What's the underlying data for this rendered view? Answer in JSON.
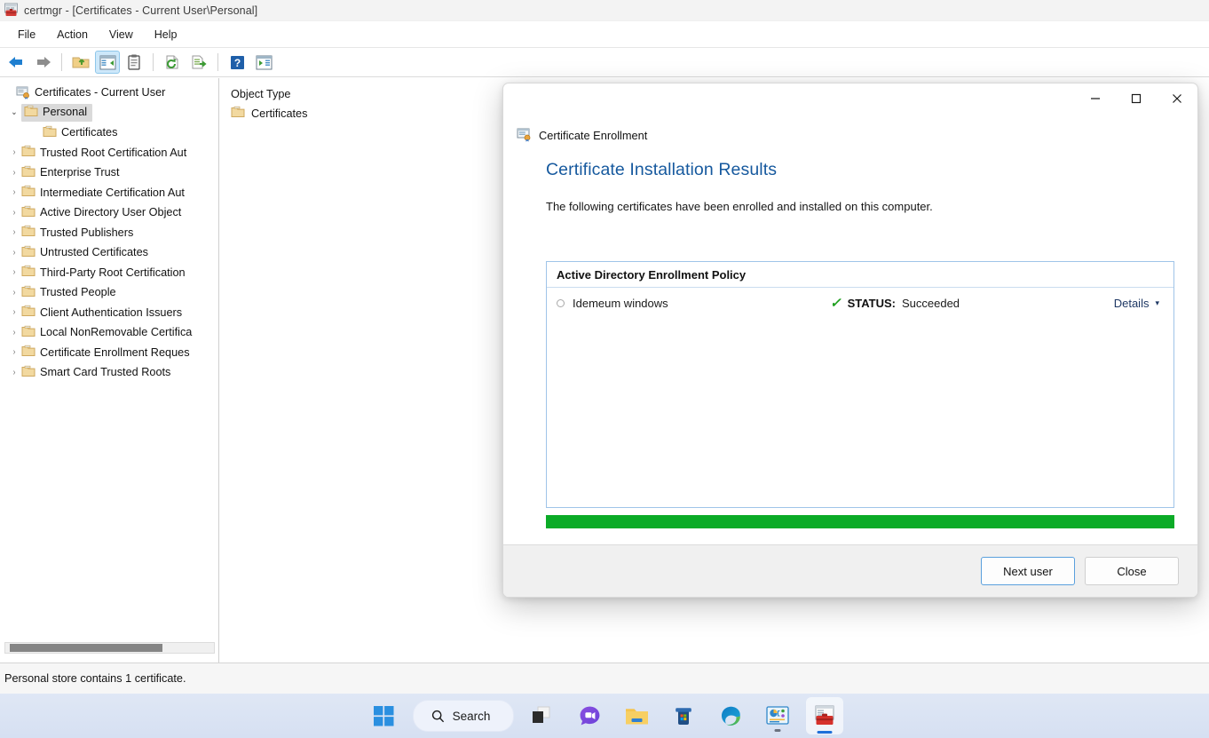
{
  "window": {
    "title": "certmgr - [Certificates - Current User\\Personal]",
    "icon": "certmgr-toolbox-icon"
  },
  "menubar": {
    "items": [
      {
        "label": "File",
        "name": "menu-file"
      },
      {
        "label": "Action",
        "name": "menu-action"
      },
      {
        "label": "View",
        "name": "menu-view"
      },
      {
        "label": "Help",
        "name": "menu-help"
      }
    ]
  },
  "toolbar": {
    "buttons": [
      {
        "name": "back-icon",
        "glyph": "back-arrow"
      },
      {
        "name": "forward-icon",
        "glyph": "forward-arrow"
      },
      {
        "name": "up-one-level-icon",
        "glyph": "folder-up"
      },
      {
        "name": "show-hide-console-tree-icon",
        "glyph": "console-tree",
        "active": true
      },
      {
        "name": "properties-icon",
        "glyph": "clipboard"
      },
      {
        "name": "refresh-icon",
        "glyph": "refresh-page"
      },
      {
        "name": "export-list-icon",
        "glyph": "export-list"
      },
      {
        "name": "help-icon",
        "glyph": "question-mark"
      },
      {
        "name": "show-action-pane-icon",
        "glyph": "action-pane"
      }
    ]
  },
  "tree": {
    "root": {
      "label": "Certificates - Current User",
      "icon": "certificates-root-icon"
    },
    "items": [
      {
        "label": "Personal",
        "twisty": "open",
        "selected": true,
        "indent": 1
      },
      {
        "label": "Certificates",
        "twisty": "none",
        "selected": false,
        "indent": 2
      },
      {
        "label": "Trusted Root Certification Aut",
        "twisty": "closed",
        "selected": false,
        "indent": 1
      },
      {
        "label": "Enterprise Trust",
        "twisty": "closed",
        "selected": false,
        "indent": 1
      },
      {
        "label": "Intermediate Certification Aut",
        "twisty": "closed",
        "selected": false,
        "indent": 1
      },
      {
        "label": "Active Directory User Object",
        "twisty": "closed",
        "selected": false,
        "indent": 1
      },
      {
        "label": "Trusted Publishers",
        "twisty": "closed",
        "selected": false,
        "indent": 1
      },
      {
        "label": "Untrusted Certificates",
        "twisty": "closed",
        "selected": false,
        "indent": 1
      },
      {
        "label": "Third-Party Root Certification",
        "twisty": "closed",
        "selected": false,
        "indent": 1
      },
      {
        "label": "Trusted People",
        "twisty": "closed",
        "selected": false,
        "indent": 1
      },
      {
        "label": "Client Authentication Issuers",
        "twisty": "closed",
        "selected": false,
        "indent": 1
      },
      {
        "label": "Local NonRemovable Certifica",
        "twisty": "closed",
        "selected": false,
        "indent": 1
      },
      {
        "label": "Certificate Enrollment Reques",
        "twisty": "closed",
        "selected": false,
        "indent": 1
      },
      {
        "label": "Smart Card Trusted Roots",
        "twisty": "closed",
        "selected": false,
        "indent": 1
      }
    ]
  },
  "list_pane": {
    "column_header": "Object Type",
    "rows": [
      {
        "label": "Certificates",
        "icon": "folder-icon"
      }
    ]
  },
  "statusbar": {
    "text": "Personal store contains 1 certificate."
  },
  "dialog": {
    "app_label": "Certificate Enrollment",
    "app_icon": "certificate-enrollment-icon",
    "heading": "Certificate Installation Results",
    "subtitle": "The following certificates have been enrolled and installed on this computer.",
    "window_buttons": {
      "minimize": "—",
      "maximize": "☐",
      "close": "✕"
    },
    "results": {
      "policy_header": "Active Directory Enrollment Policy",
      "rows": [
        {
          "name": "Idemeum windows",
          "status_label": "STATUS:",
          "status_value": "Succeeded",
          "status_icon": "green-check-icon",
          "details_label": "Details",
          "details_chevron": "▾"
        }
      ]
    },
    "progress": {
      "percent": 100,
      "color": "#0bab27"
    },
    "buttons": [
      {
        "label": "Next user",
        "name": "next-user-button",
        "default": true
      },
      {
        "label": "Close",
        "name": "close-button",
        "default": false
      }
    ]
  },
  "taskbar": {
    "search_placeholder": "Search",
    "items": [
      {
        "name": "start-button",
        "icon": "windows-logo-icon"
      },
      {
        "name": "search-box",
        "icon": "search-icon"
      },
      {
        "name": "task-view-button",
        "icon": "task-view-icon"
      },
      {
        "name": "chat-button",
        "icon": "chat-icon"
      },
      {
        "name": "file-explorer-button",
        "icon": "folder-icon"
      },
      {
        "name": "microsoft-store-button",
        "icon": "store-icon"
      },
      {
        "name": "edge-button",
        "icon": "edge-icon"
      },
      {
        "name": "mmc-console-button",
        "icon": "mmc-console-icon",
        "running": true
      },
      {
        "name": "certmgr-button",
        "icon": "certmgr-toolbox-icon",
        "active": true
      }
    ]
  },
  "colors": {
    "heading_blue": "#16599e",
    "progress_green": "#0bab27",
    "status_check_green": "#21a121",
    "accent_taskbar": "#1e6fd9"
  }
}
